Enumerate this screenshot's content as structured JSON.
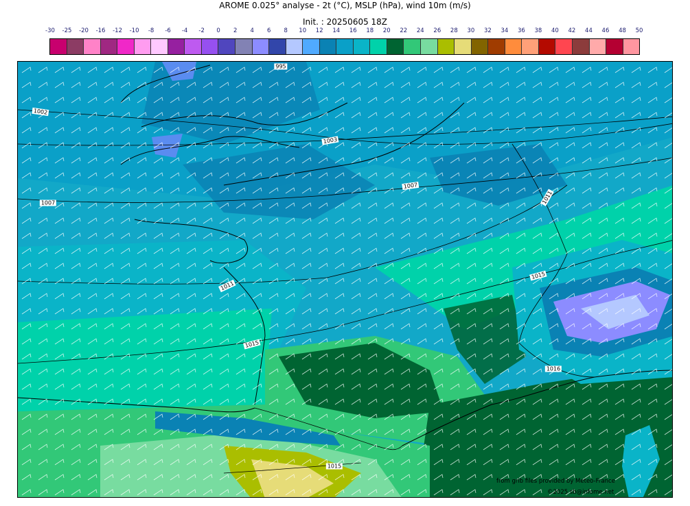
{
  "header": {
    "title": "AROME 0.025° analyse - 2t (°C), MSLP (hPa), wind 10m (m/s)",
    "init": "Init. : 20250605 18Z"
  },
  "legend": {
    "labels": [
      "-30",
      "-25",
      "-20",
      "-16",
      "-12",
      "-10",
      "-8",
      "-6",
      "-4",
      "-2",
      "0",
      "2",
      "4",
      "6",
      "8",
      "10",
      "12",
      "14",
      "16",
      "18",
      "20",
      "22",
      "24",
      "26",
      "28",
      "30",
      "32",
      "34",
      "36",
      "38",
      "40",
      "42",
      "44",
      "46",
      "48",
      "50"
    ],
    "colors": [
      "#c8006e",
      "#8c3c64",
      "#ff82c8",
      "#a02882",
      "#f028c8",
      "#ff9cf0",
      "#ffc8ff",
      "#9620a0",
      "#be5af0",
      "#9650f0",
      "#5046be",
      "#8282b4",
      "#8c8cff",
      "#3246aa",
      "#b4c8ff",
      "#50aaff",
      "#0a82b4",
      "#0aa0c8",
      "#0ab4c8",
      "#00d2aa",
      "#006432",
      "#32c878",
      "#78dca0",
      "#aabe00",
      "#e6dc78",
      "#826400",
      "#a03c00",
      "#ff8c3c",
      "#ffa078",
      "#b40a00",
      "#ff4650",
      "#8c3c3c",
      "#ffaaaa",
      "#b40032",
      "#ff96a0"
    ]
  },
  "isobars": [
    {
      "text": "995"
    },
    {
      "text": "1002"
    },
    {
      "text": "1003"
    },
    {
      "text": "1007"
    },
    {
      "text": "1007"
    },
    {
      "text": "1011"
    },
    {
      "text": "1011"
    },
    {
      "text": "1015"
    },
    {
      "text": "1015"
    },
    {
      "text": "1016"
    },
    {
      "text": "1015"
    }
  ],
  "footer": {
    "source": "from grib files provided by Meteo-France",
    "copyright": "©2025 sb@infome.net"
  },
  "colors": {
    "sea": "#12a8c8",
    "cool": "#0a82b4",
    "teal": "#0ab4c8",
    "green_light": "#00d2aa",
    "green": "#32c878",
    "green_pale": "#78dca0",
    "green_dark": "#006432",
    "yellow": "#aabe00",
    "yellow_pale": "#e6dc78",
    "blue_cold": "#5a8cf0",
    "purple_mount": "#8c8cff"
  }
}
